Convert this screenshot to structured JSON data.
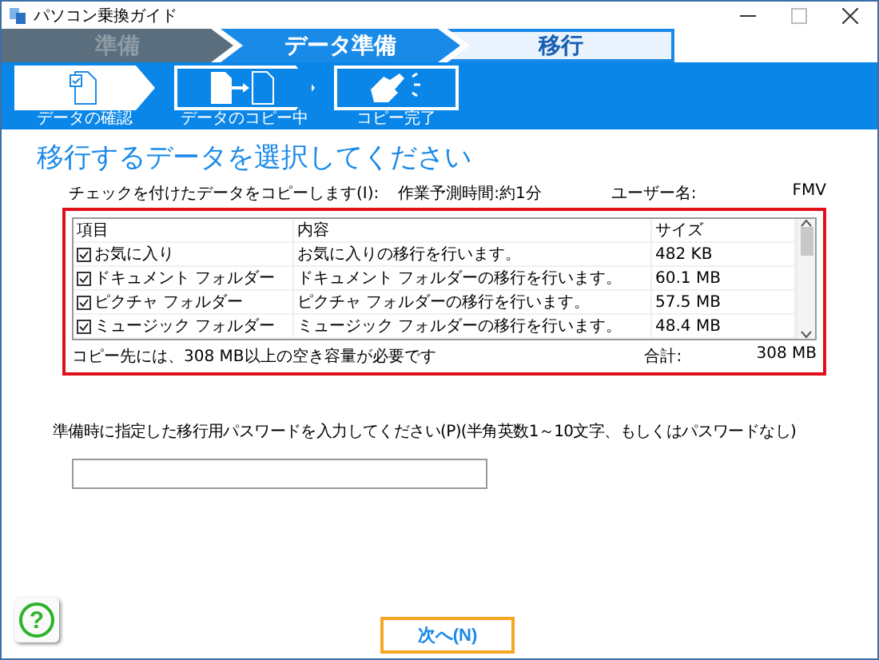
{
  "window": {
    "title": "パソコン乗換ガイド"
  },
  "stages": [
    {
      "label": "準備",
      "kind": "done"
    },
    {
      "label": "データ準備",
      "kind": "current"
    },
    {
      "label": "移行",
      "kind": "upcoming"
    }
  ],
  "steps": [
    {
      "label": "データの確認",
      "selected": true
    },
    {
      "label": "データのコピー中",
      "selected": false
    },
    {
      "label": "コピー完了",
      "selected": false
    }
  ],
  "heading": "移行するデータを選択してください",
  "info": {
    "copy_label": "チェックを付けたデータをコピーします(I):",
    "time": "作業予測時間:約1分",
    "user_label": "ユーザー名:",
    "user": "FMV"
  },
  "table": {
    "columns": [
      "項目",
      "内容",
      "サイズ"
    ],
    "rows": [
      {
        "item": "お気に入り",
        "content": "お気に入りの移行を行います。",
        "size": "482 KB",
        "checked": true
      },
      {
        "item": "ドキュメント フォルダー",
        "content": "ドキュメント フォルダーの移行を行います。",
        "size": "60.1 MB",
        "checked": true
      },
      {
        "item": "ピクチャ フォルダー",
        "content": "ピクチャ フォルダーの移行を行います。",
        "size": "57.5 MB",
        "checked": true
      },
      {
        "item": "ミュージック フォルダー",
        "content": "ミュージック フォルダーの移行を行います。",
        "size": "48.4 MB",
        "checked": true
      }
    ]
  },
  "summary": {
    "note": "コピー先には、308 MB以上の空き容量が必要です",
    "total_label": "合計:",
    "total": "308 MB"
  },
  "password": {
    "label": "準備時に指定した移行用パスワードを入力してください(P)(半角英数1～10文字、もしくはパスワードなし)"
  },
  "buttons": {
    "help": "?",
    "next": "次へ(N)"
  }
}
